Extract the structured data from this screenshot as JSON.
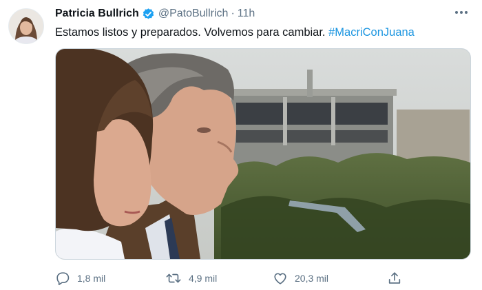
{
  "tweet": {
    "display_name": "Patricia Bullrich",
    "handle": "@PatoBullrich",
    "separator": "·",
    "time": "11h",
    "text_main": "Estamos listos y preparados. Volvemos para cambiar.",
    "hashtag": "#MacriConJuana"
  },
  "actions": {
    "replies": "1,8 mil",
    "retweets": "4,9 mil",
    "likes": "20,3 mil"
  },
  "icons": {
    "verified": "verified-badge-icon",
    "more": "more-options-icon",
    "reply": "reply-icon",
    "retweet": "retweet-icon",
    "like": "heart-icon",
    "share": "share-icon"
  },
  "colors": {
    "accent": "#1da1f2",
    "hashtag": "#1b95e0",
    "muted": "#5b7083",
    "text": "#0f1419"
  }
}
